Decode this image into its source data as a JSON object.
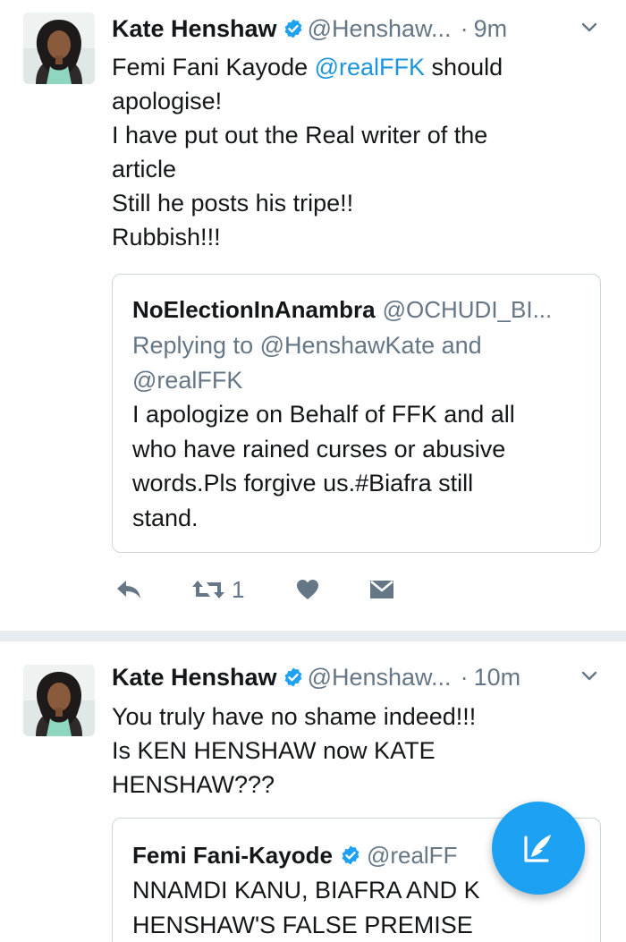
{
  "tweets": [
    {
      "name": "Kate Henshaw",
      "handle": "@Henshaw...",
      "dot": "·",
      "time": "9m",
      "body_lines": [
        {
          "pre": "Femi Fani Kayode ",
          "mention": "@realFFK",
          "post": " should"
        },
        {
          "text": "apologise!"
        },
        {
          "text": "I have put out the Real writer of the"
        },
        {
          "text": "article"
        },
        {
          "text": "Still he posts his tripe!!"
        },
        {
          "text": "Rubbish!!!"
        }
      ],
      "quote": {
        "name": "NoElectionInAnambra",
        "handle": "@OCHUDI_BI...",
        "replying_lines": [
          "Replying to @HenshawKate and",
          "@realFFK"
        ],
        "text_lines": [
          "I apologize on Behalf of FFK and all",
          "who  have rained curses or abusive",
          "words.Pls forgive us.#Biafra still",
          "stand."
        ]
      },
      "actions": {
        "retweet_count": "1"
      }
    },
    {
      "name": "Kate Henshaw",
      "handle": "@Henshaw...",
      "dot": "·",
      "time": "10m",
      "body_lines": [
        {
          "text": "You truly have no shame indeed!!!"
        },
        {
          "text": "Is KEN HENSHAW now KATE"
        },
        {
          "text": "HENSHAW???"
        }
      ],
      "quote": {
        "name": "Femi Fani-Kayode",
        "handle": "@realFF",
        "text_lines": [
          "NNAMDI KANU, BIAFRA AND K",
          "HENSHAW'S FALSE PREMISE"
        ]
      }
    }
  ],
  "icons": {
    "verified": "verified-badge-icon",
    "chevron": "chevron-down-icon",
    "reply": "reply-icon",
    "retweet": "retweet-icon",
    "like": "heart-icon",
    "dm": "direct-message-icon",
    "compose": "compose-tweet-icon"
  },
  "colors": {
    "accent": "#1da1f2",
    "mention": "#1b95e0",
    "muted": "#657786",
    "action_icon": "#657786",
    "separator": "#e6ecf0"
  }
}
